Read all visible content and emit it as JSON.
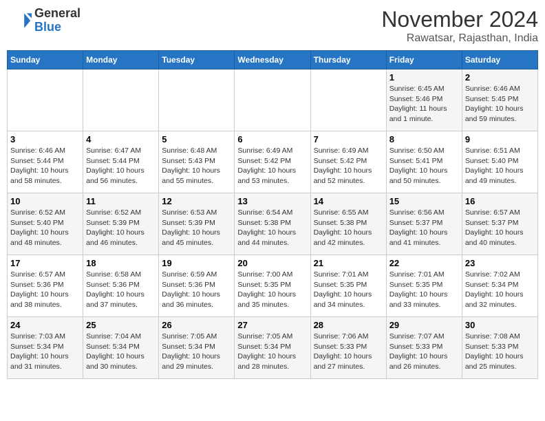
{
  "header": {
    "logo_line1": "General",
    "logo_line2": "Blue",
    "month": "November 2024",
    "location": "Rawatsar, Rajasthan, India"
  },
  "weekdays": [
    "Sunday",
    "Monday",
    "Tuesday",
    "Wednesday",
    "Thursday",
    "Friday",
    "Saturday"
  ],
  "weeks": [
    [
      {
        "day": "",
        "info": ""
      },
      {
        "day": "",
        "info": ""
      },
      {
        "day": "",
        "info": ""
      },
      {
        "day": "",
        "info": ""
      },
      {
        "day": "",
        "info": ""
      },
      {
        "day": "1",
        "info": "Sunrise: 6:45 AM\nSunset: 5:46 PM\nDaylight: 11 hours\nand 1 minute."
      },
      {
        "day": "2",
        "info": "Sunrise: 6:46 AM\nSunset: 5:45 PM\nDaylight: 10 hours\nand 59 minutes."
      }
    ],
    [
      {
        "day": "3",
        "info": "Sunrise: 6:46 AM\nSunset: 5:44 PM\nDaylight: 10 hours\nand 58 minutes."
      },
      {
        "day": "4",
        "info": "Sunrise: 6:47 AM\nSunset: 5:44 PM\nDaylight: 10 hours\nand 56 minutes."
      },
      {
        "day": "5",
        "info": "Sunrise: 6:48 AM\nSunset: 5:43 PM\nDaylight: 10 hours\nand 55 minutes."
      },
      {
        "day": "6",
        "info": "Sunrise: 6:49 AM\nSunset: 5:42 PM\nDaylight: 10 hours\nand 53 minutes."
      },
      {
        "day": "7",
        "info": "Sunrise: 6:49 AM\nSunset: 5:42 PM\nDaylight: 10 hours\nand 52 minutes."
      },
      {
        "day": "8",
        "info": "Sunrise: 6:50 AM\nSunset: 5:41 PM\nDaylight: 10 hours\nand 50 minutes."
      },
      {
        "day": "9",
        "info": "Sunrise: 6:51 AM\nSunset: 5:40 PM\nDaylight: 10 hours\nand 49 minutes."
      }
    ],
    [
      {
        "day": "10",
        "info": "Sunrise: 6:52 AM\nSunset: 5:40 PM\nDaylight: 10 hours\nand 48 minutes."
      },
      {
        "day": "11",
        "info": "Sunrise: 6:52 AM\nSunset: 5:39 PM\nDaylight: 10 hours\nand 46 minutes."
      },
      {
        "day": "12",
        "info": "Sunrise: 6:53 AM\nSunset: 5:39 PM\nDaylight: 10 hours\nand 45 minutes."
      },
      {
        "day": "13",
        "info": "Sunrise: 6:54 AM\nSunset: 5:38 PM\nDaylight: 10 hours\nand 44 minutes."
      },
      {
        "day": "14",
        "info": "Sunrise: 6:55 AM\nSunset: 5:38 PM\nDaylight: 10 hours\nand 42 minutes."
      },
      {
        "day": "15",
        "info": "Sunrise: 6:56 AM\nSunset: 5:37 PM\nDaylight: 10 hours\nand 41 minutes."
      },
      {
        "day": "16",
        "info": "Sunrise: 6:57 AM\nSunset: 5:37 PM\nDaylight: 10 hours\nand 40 minutes."
      }
    ],
    [
      {
        "day": "17",
        "info": "Sunrise: 6:57 AM\nSunset: 5:36 PM\nDaylight: 10 hours\nand 38 minutes."
      },
      {
        "day": "18",
        "info": "Sunrise: 6:58 AM\nSunset: 5:36 PM\nDaylight: 10 hours\nand 37 minutes."
      },
      {
        "day": "19",
        "info": "Sunrise: 6:59 AM\nSunset: 5:36 PM\nDaylight: 10 hours\nand 36 minutes."
      },
      {
        "day": "20",
        "info": "Sunrise: 7:00 AM\nSunset: 5:35 PM\nDaylight: 10 hours\nand 35 minutes."
      },
      {
        "day": "21",
        "info": "Sunrise: 7:01 AM\nSunset: 5:35 PM\nDaylight: 10 hours\nand 34 minutes."
      },
      {
        "day": "22",
        "info": "Sunrise: 7:01 AM\nSunset: 5:35 PM\nDaylight: 10 hours\nand 33 minutes."
      },
      {
        "day": "23",
        "info": "Sunrise: 7:02 AM\nSunset: 5:34 PM\nDaylight: 10 hours\nand 32 minutes."
      }
    ],
    [
      {
        "day": "24",
        "info": "Sunrise: 7:03 AM\nSunset: 5:34 PM\nDaylight: 10 hours\nand 31 minutes."
      },
      {
        "day": "25",
        "info": "Sunrise: 7:04 AM\nSunset: 5:34 PM\nDaylight: 10 hours\nand 30 minutes."
      },
      {
        "day": "26",
        "info": "Sunrise: 7:05 AM\nSunset: 5:34 PM\nDaylight: 10 hours\nand 29 minutes."
      },
      {
        "day": "27",
        "info": "Sunrise: 7:05 AM\nSunset: 5:34 PM\nDaylight: 10 hours\nand 28 minutes."
      },
      {
        "day": "28",
        "info": "Sunrise: 7:06 AM\nSunset: 5:33 PM\nDaylight: 10 hours\nand 27 minutes."
      },
      {
        "day": "29",
        "info": "Sunrise: 7:07 AM\nSunset: 5:33 PM\nDaylight: 10 hours\nand 26 minutes."
      },
      {
        "day": "30",
        "info": "Sunrise: 7:08 AM\nSunset: 5:33 PM\nDaylight: 10 hours\nand 25 minutes."
      }
    ]
  ]
}
